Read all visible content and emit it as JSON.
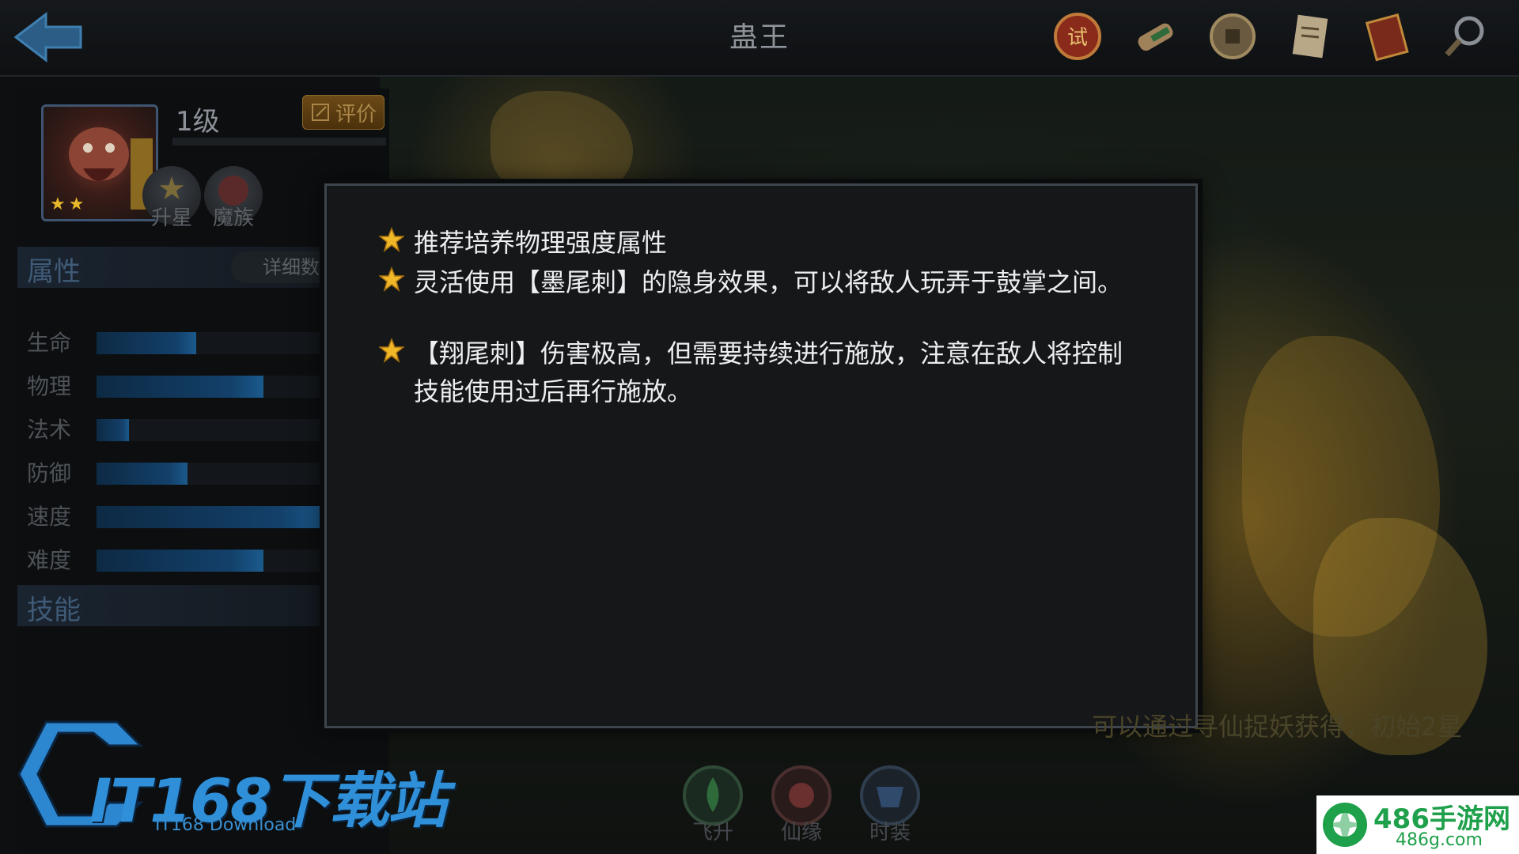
{
  "header": {
    "title": "蛊王",
    "icons": [
      "trial-seal-icon",
      "scroll-icon",
      "coin-icon",
      "document-icon",
      "book-icon",
      "magnifier-icon"
    ]
  },
  "hero": {
    "level": "1级",
    "rate_label": "评价",
    "stars": 2,
    "badges": [
      {
        "label": "升星",
        "icon": "star-badge-icon"
      },
      {
        "label": "魔族",
        "icon": "demon-clan-icon"
      }
    ]
  },
  "attributes": {
    "title": "属性",
    "detail_label": "详细数",
    "stats": [
      {
        "label": "生命",
        "value": 0.34
      },
      {
        "label": "物理",
        "value": 0.57
      },
      {
        "label": "法术",
        "value": 0.11
      },
      {
        "label": "防御",
        "value": 0.31
      },
      {
        "label": "速度",
        "value": 0.78
      },
      {
        "label": "难度",
        "value": 0.57
      }
    ]
  },
  "skills": {
    "title": "技能"
  },
  "modal": {
    "tips": [
      "推荐培养物理强度属性",
      "灵活使用【墨尾刺】的隐身效果，可以将敌人玩弄于鼓掌之间。",
      "【翔尾刺】伤害极高，但需要持续进行施放，注意在敌人将控制技能使用过后再行施放。"
    ]
  },
  "obtain_text": "可以通过寻仙捉妖获得，初始2星",
  "bottom_tabs": [
    {
      "label": "飞升",
      "color": "#2f6a3a"
    },
    {
      "label": "仙缘",
      "color": "#6a2f2f"
    },
    {
      "label": "时装",
      "color": "#2f4a6a"
    }
  ],
  "watermarks": {
    "it168": "IT168下载站",
    "it168_sub": "IT168 Download",
    "site486": "486手游网",
    "site486_url": "486g.com"
  }
}
